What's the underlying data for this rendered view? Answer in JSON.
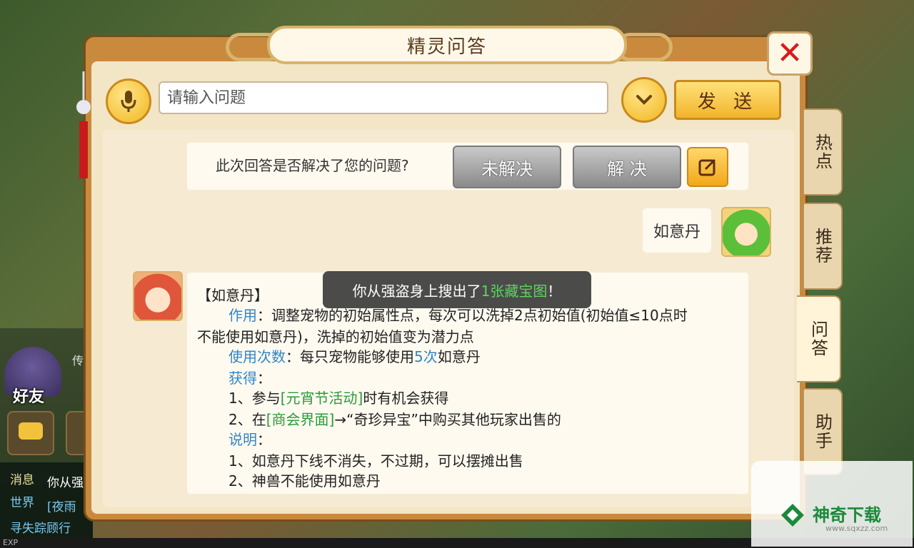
{
  "dialog": {
    "title": "精灵问答"
  },
  "search": {
    "placeholder": "请输入问题",
    "send_label": "发 送"
  },
  "feedback": {
    "question": "此次回答是否解决了您的问题?",
    "unsolved_label": "未解决",
    "solved_label": "解 决"
  },
  "user_message": "如意丹",
  "answer": {
    "title": "【如意丹】",
    "effect_label": "作用",
    "effect_text": "：调整宠物的初始属性点，每次可以洗掉2点初始值(初始值≤10点时",
    "effect_text_2": "不能使用如意丹)，洗掉的初始值变为潜力点",
    "uses_label": "使用次数",
    "uses_text_pre": "：每只宠物能够使用",
    "uses_count": "5次",
    "uses_text_post": "如意丹",
    "obtain_label": "获得",
    "obtain_colon": "：",
    "obtain_1_pre": "1、参与",
    "obtain_1_link": "[元宵节活动]",
    "obtain_1_post": "时有机会获得",
    "obtain_2_pre": "2、在",
    "obtain_2_link": "[商会界面]",
    "obtain_2_post": "→“奇珍异宝”中购买其他玩家出售的",
    "note_label": "说明",
    "note_colon": "：",
    "note_1": "1、如意丹下线不消失，不过期，可以摆摊出售",
    "note_2": "2、神兽不能使用如意丹"
  },
  "toast": {
    "pre": "你从强盗身上搜出了",
    "count": "1张",
    "item": "藏宝图",
    "post": "！"
  },
  "side_tabs": [
    "热点",
    "推荐",
    "问答",
    "助手"
  ],
  "background": {
    "friend_label": "好友",
    "chat_lines": [
      "消息",
      "你从强",
      "世界",
      "[夜雨",
      "寻失踪顾行"
    ],
    "exp_label": "EXP"
  },
  "watermark": {
    "text": "神奇下载",
    "url": "www.sqxzz.com"
  },
  "colors": {
    "accent_blue": "#2e86c8",
    "link_green": "#2a9a3a",
    "close_red": "#d91a1a"
  }
}
